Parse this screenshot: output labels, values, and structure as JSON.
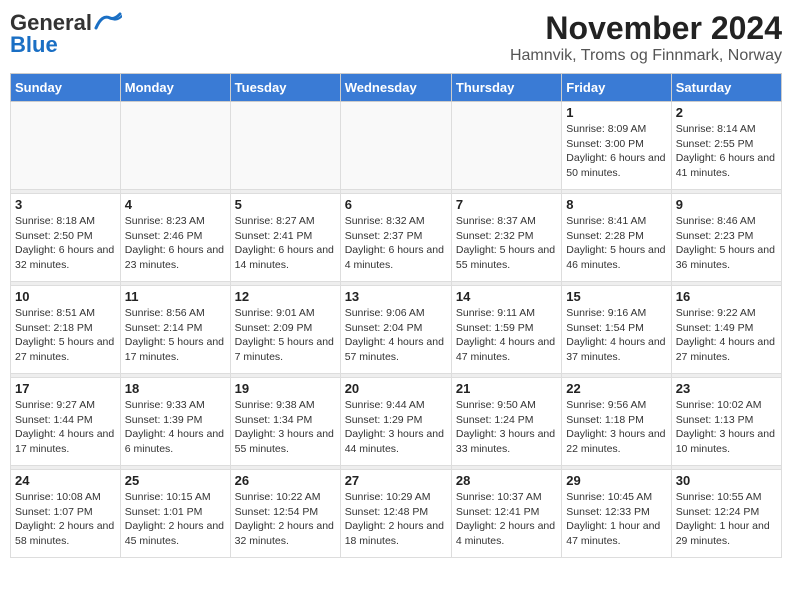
{
  "logo": {
    "general": "General",
    "blue": "Blue"
  },
  "title": "November 2024",
  "subtitle": "Hamnvik, Troms og Finnmark, Norway",
  "days_of_week": [
    "Sunday",
    "Monday",
    "Tuesday",
    "Wednesday",
    "Thursday",
    "Friday",
    "Saturday"
  ],
  "weeks": [
    {
      "cells": [
        {
          "empty": true
        },
        {
          "empty": true
        },
        {
          "empty": true
        },
        {
          "empty": true
        },
        {
          "empty": true
        },
        {
          "day": "1",
          "sunrise": "Sunrise: 8:09 AM",
          "sunset": "Sunset: 3:00 PM",
          "daylight": "Daylight: 6 hours and 50 minutes."
        },
        {
          "day": "2",
          "sunrise": "Sunrise: 8:14 AM",
          "sunset": "Sunset: 2:55 PM",
          "daylight": "Daylight: 6 hours and 41 minutes."
        }
      ]
    },
    {
      "cells": [
        {
          "day": "3",
          "sunrise": "Sunrise: 8:18 AM",
          "sunset": "Sunset: 2:50 PM",
          "daylight": "Daylight: 6 hours and 32 minutes."
        },
        {
          "day": "4",
          "sunrise": "Sunrise: 8:23 AM",
          "sunset": "Sunset: 2:46 PM",
          "daylight": "Daylight: 6 hours and 23 minutes."
        },
        {
          "day": "5",
          "sunrise": "Sunrise: 8:27 AM",
          "sunset": "Sunset: 2:41 PM",
          "daylight": "Daylight: 6 hours and 14 minutes."
        },
        {
          "day": "6",
          "sunrise": "Sunrise: 8:32 AM",
          "sunset": "Sunset: 2:37 PM",
          "daylight": "Daylight: 6 hours and 4 minutes."
        },
        {
          "day": "7",
          "sunrise": "Sunrise: 8:37 AM",
          "sunset": "Sunset: 2:32 PM",
          "daylight": "Daylight: 5 hours and 55 minutes."
        },
        {
          "day": "8",
          "sunrise": "Sunrise: 8:41 AM",
          "sunset": "Sunset: 2:28 PM",
          "daylight": "Daylight: 5 hours and 46 minutes."
        },
        {
          "day": "9",
          "sunrise": "Sunrise: 8:46 AM",
          "sunset": "Sunset: 2:23 PM",
          "daylight": "Daylight: 5 hours and 36 minutes."
        }
      ]
    },
    {
      "cells": [
        {
          "day": "10",
          "sunrise": "Sunrise: 8:51 AM",
          "sunset": "Sunset: 2:18 PM",
          "daylight": "Daylight: 5 hours and 27 minutes."
        },
        {
          "day": "11",
          "sunrise": "Sunrise: 8:56 AM",
          "sunset": "Sunset: 2:14 PM",
          "daylight": "Daylight: 5 hours and 17 minutes."
        },
        {
          "day": "12",
          "sunrise": "Sunrise: 9:01 AM",
          "sunset": "Sunset: 2:09 PM",
          "daylight": "Daylight: 5 hours and 7 minutes."
        },
        {
          "day": "13",
          "sunrise": "Sunrise: 9:06 AM",
          "sunset": "Sunset: 2:04 PM",
          "daylight": "Daylight: 4 hours and 57 minutes."
        },
        {
          "day": "14",
          "sunrise": "Sunrise: 9:11 AM",
          "sunset": "Sunset: 1:59 PM",
          "daylight": "Daylight: 4 hours and 47 minutes."
        },
        {
          "day": "15",
          "sunrise": "Sunrise: 9:16 AM",
          "sunset": "Sunset: 1:54 PM",
          "daylight": "Daylight: 4 hours and 37 minutes."
        },
        {
          "day": "16",
          "sunrise": "Sunrise: 9:22 AM",
          "sunset": "Sunset: 1:49 PM",
          "daylight": "Daylight: 4 hours and 27 minutes."
        }
      ]
    },
    {
      "cells": [
        {
          "day": "17",
          "sunrise": "Sunrise: 9:27 AM",
          "sunset": "Sunset: 1:44 PM",
          "daylight": "Daylight: 4 hours and 17 minutes."
        },
        {
          "day": "18",
          "sunrise": "Sunrise: 9:33 AM",
          "sunset": "Sunset: 1:39 PM",
          "daylight": "Daylight: 4 hours and 6 minutes."
        },
        {
          "day": "19",
          "sunrise": "Sunrise: 9:38 AM",
          "sunset": "Sunset: 1:34 PM",
          "daylight": "Daylight: 3 hours and 55 minutes."
        },
        {
          "day": "20",
          "sunrise": "Sunrise: 9:44 AM",
          "sunset": "Sunset: 1:29 PM",
          "daylight": "Daylight: 3 hours and 44 minutes."
        },
        {
          "day": "21",
          "sunrise": "Sunrise: 9:50 AM",
          "sunset": "Sunset: 1:24 PM",
          "daylight": "Daylight: 3 hours and 33 minutes."
        },
        {
          "day": "22",
          "sunrise": "Sunrise: 9:56 AM",
          "sunset": "Sunset: 1:18 PM",
          "daylight": "Daylight: 3 hours and 22 minutes."
        },
        {
          "day": "23",
          "sunrise": "Sunrise: 10:02 AM",
          "sunset": "Sunset: 1:13 PM",
          "daylight": "Daylight: 3 hours and 10 minutes."
        }
      ]
    },
    {
      "cells": [
        {
          "day": "24",
          "sunrise": "Sunrise: 10:08 AM",
          "sunset": "Sunset: 1:07 PM",
          "daylight": "Daylight: 2 hours and 58 minutes."
        },
        {
          "day": "25",
          "sunrise": "Sunrise: 10:15 AM",
          "sunset": "Sunset: 1:01 PM",
          "daylight": "Daylight: 2 hours and 45 minutes."
        },
        {
          "day": "26",
          "sunrise": "Sunrise: 10:22 AM",
          "sunset": "Sunset: 12:54 PM",
          "daylight": "Daylight: 2 hours and 32 minutes."
        },
        {
          "day": "27",
          "sunrise": "Sunrise: 10:29 AM",
          "sunset": "Sunset: 12:48 PM",
          "daylight": "Daylight: 2 hours and 18 minutes."
        },
        {
          "day": "28",
          "sunrise": "Sunrise: 10:37 AM",
          "sunset": "Sunset: 12:41 PM",
          "daylight": "Daylight: 2 hours and 4 minutes."
        },
        {
          "day": "29",
          "sunrise": "Sunrise: 10:45 AM",
          "sunset": "Sunset: 12:33 PM",
          "daylight": "Daylight: 1 hour and 47 minutes."
        },
        {
          "day": "30",
          "sunrise": "Sunrise: 10:55 AM",
          "sunset": "Sunset: 12:24 PM",
          "daylight": "Daylight: 1 hour and 29 minutes."
        }
      ]
    }
  ]
}
